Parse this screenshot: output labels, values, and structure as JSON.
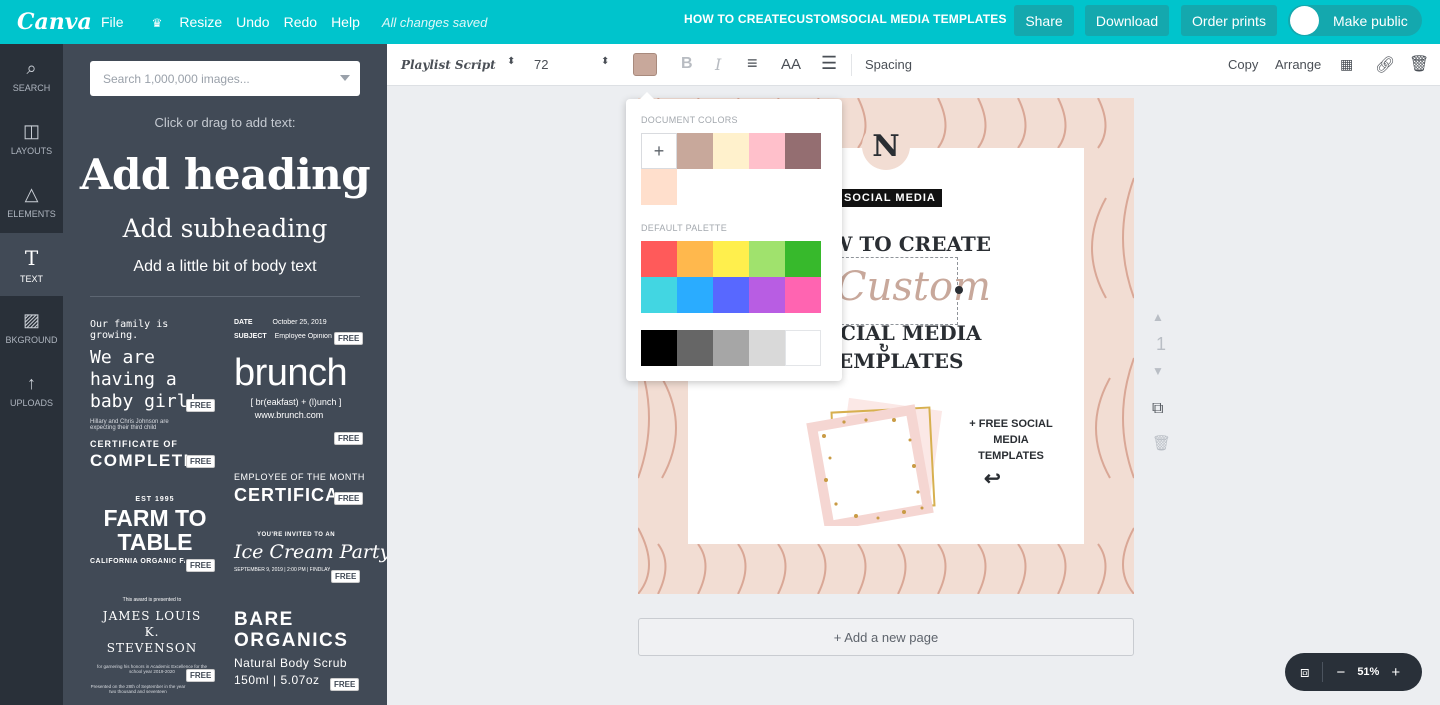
{
  "topbar": {
    "logo": "Canva",
    "menu": [
      "File",
      "Resize",
      "Undo",
      "Redo",
      "Help"
    ],
    "saved_status": "All changes saved",
    "doc_title": "HOW TO CREATECUSTOMSOCIAL MEDIA TEMPLATES",
    "share": "Share",
    "download": "Download",
    "order_prints": "Order prints",
    "make_public": "Make public"
  },
  "leftnav": [
    "SEARCH",
    "LAYOUTS",
    "ELEMENTS",
    "TEXT",
    "BKGROUND",
    "UPLOADS"
  ],
  "panel": {
    "search_placeholder": "Search 1,000,000 images...",
    "hint": "Click or drag to add text:",
    "heading": "Add heading",
    "subheading": "Add subheading",
    "body": "Add a little bit of body text",
    "free": "FREE",
    "templates": {
      "baby_small": "Our family is growing.",
      "baby_big": "We are having a baby girl!",
      "baby_note": "Hillary and Chris Johnson are expecting their third child",
      "date_label": "DATE",
      "date_value": "October 25, 2019",
      "subject_label": "SUBJECT",
      "subject_value": "Employee Opinion",
      "brunch": "brunch",
      "brunch_sub": "[ br(eakfast) + (l)unch ]",
      "brunch_url": "www.brunch.com",
      "cert_small": "CERTIFICATE OF",
      "cert_big": "COMPLETION",
      "emp_small": "EMPLOYEE OF THE MONTH",
      "emp_big": "CERTIFICATE",
      "est": "EST 1995",
      "farm": "FARM TO TABLE",
      "farm_sub": "CALIFORNIA ORGANIC FARM",
      "invited": "YOU'RE INVITED TO AN",
      "icecream": "Ice Cream Party",
      "icecream_date": "SEPTEMBER 9, 2019 | 2:00 PM | FINDLAY",
      "award": "This award is presented to",
      "james": "JAMES LOUIS K. STEVENSON",
      "award_note": "for garnering his honors in Academic Excellence for the school year 2019-2020",
      "award_note2": "Presented on the 28th of September in the year two thousand and seventeen",
      "bare": "BARE ORGANICS",
      "bare_sub": "Natural Body Scrub",
      "bare_size": "150ml | 5.07oz"
    }
  },
  "toolbar": {
    "font": "Playlist Script",
    "size": "72",
    "spacing": "Spacing",
    "copy": "Copy",
    "arrange": "Arrange",
    "aa": "AA"
  },
  "colors": {
    "current": "#c8a89b",
    "doc_label": "DOCUMENT COLORS",
    "default_label": "DEFAULT PALETTE",
    "document": [
      "#c8a89b",
      "#fff1cc",
      "#ffc0cb",
      "#946e71",
      "#ffdfcc"
    ],
    "default_row1": [
      "#ff5a5a",
      "#ffb84d",
      "#ffef4d",
      "#a0e26d",
      "#37b92c"
    ],
    "default_row2": [
      "#42d6e2",
      "#2aacff",
      "#5868ff",
      "#b85de3",
      "#ff64b1"
    ],
    "grays": [
      "#000000",
      "#666666",
      "#a6a6a6",
      "#d9d9d9",
      "#ffffff"
    ]
  },
  "design": {
    "badge": "SOCIAL MEDIA",
    "line1": "W TO CREATE",
    "custom": "Custom",
    "line2": "CIAL MEDIA",
    "line3": "EMPLATES",
    "monogram": "N",
    "free_note": "+ FREE SOCIAL MEDIA TEMPLATES"
  },
  "page_number": "1",
  "add_page": "+ Add a new page",
  "zoom": "51%"
}
